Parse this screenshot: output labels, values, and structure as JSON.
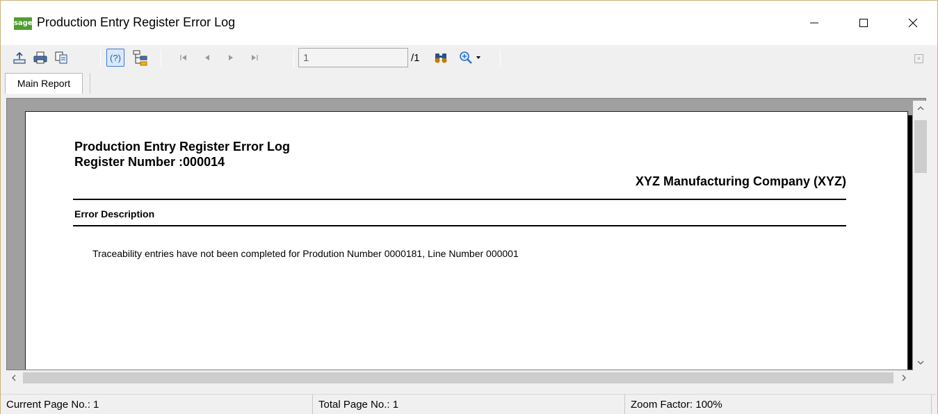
{
  "window": {
    "logo_text": "sage",
    "title": "Production Entry Register Error Log"
  },
  "toolbar": {
    "export_icon": "export-icon",
    "print_icon": "printer-icon",
    "copy_icon": "copy-icon",
    "help_icon": "help-icon",
    "help_label": "(?)",
    "group_tree_icon": "group-tree-icon",
    "page_value": "1",
    "page_total": "/1",
    "search_icon": "binoculars-icon",
    "zoom_icon": "zoom-icon",
    "close_glyph": "×"
  },
  "tabs": [
    {
      "label": "Main Report"
    }
  ],
  "report": {
    "title": "Production Entry Register Error Log",
    "register_label": "Register Number :",
    "register_number": "000014",
    "company": "XYZ Manufacturing Company (XYZ)",
    "column_header": "Error Description",
    "message": "Traceability entries have not been completed for Prodution Number 0000181, Line Number 000001"
  },
  "status": {
    "current_page": "Current Page No.: 1",
    "total_page": "Total Page No.: 1",
    "zoom": "Zoom Factor: 100%"
  },
  "colors": {
    "logo_green": "#4f9e2f",
    "window_border": "#c9b27a",
    "viewport_gray": "#a0a0a0",
    "help_blue": "#3a78d6"
  }
}
